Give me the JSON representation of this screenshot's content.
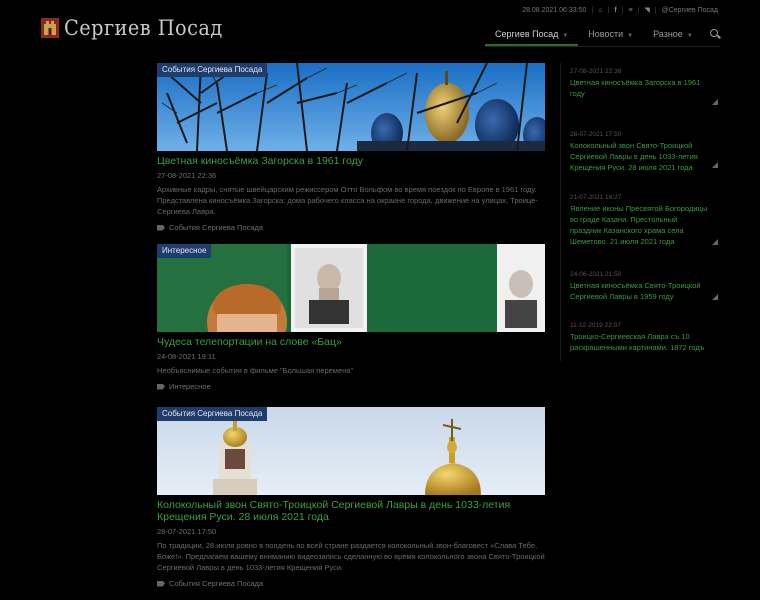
{
  "header": {
    "logo_text": "Сергиев Посад",
    "datetime": "28.08.2021 06:33:50",
    "social_handle": "@Сергиев Посад",
    "nav": [
      {
        "label": "Сергиев Посад",
        "active": true
      },
      {
        "label": "Новости",
        "active": false
      },
      {
        "label": "Разное",
        "active": false
      }
    ],
    "icons": [
      "home-icon",
      "facebook-icon",
      "menu-icon",
      "rss-icon"
    ]
  },
  "articles": [
    {
      "badge": "События Сергиева Посада",
      "title": "Цветная киносъёмка Загорска в 1961 году",
      "date": "27-08-2021 22:36",
      "desc": "Архивные кадры, снятые швейцарским режиссером Отто Вольфом во время поездок по Европе в 1961 году. Представлена киносъёмка Загорска: дома рабочего класса на окраине города, движение на улицах, Троице-Сергиева Лавра.",
      "tag": "События Сергиева Посада"
    },
    {
      "badge": "Интересное",
      "title": "Чудеса телепортации на слове «Бац»",
      "date": "24-08-2021 19:11",
      "desc": "Необъяснимые события в фильме \"Большая перемена\"",
      "tag": "Интересное"
    },
    {
      "badge": "События Сергиева Посада",
      "title": "Колокольный звон Свято-Троицкой Сергиевой Лавры в день 1033-летия Крещения Руси. 28 июля 2021 года",
      "date": "28-07-2021 17:50",
      "desc": "По традиции, 28 июля ровно в полдень по всей стране раздается колокольный звон-благовест «Слава Тебе, Боже!». Предлагаем вашему вниманию видеозапись сделанную во время колокольного звона Свято-Троицкой Сергиевой Лавры в день 1033-летия Крещения Руси.",
      "tag": "События Сергиева Посада"
    }
  ],
  "sidebar": [
    {
      "date": "27-08-2021 22:36",
      "title": "Цветная киносъёмка Загорска в 1961 году"
    },
    {
      "date": "28-07-2021 17:50",
      "title": "Колокольный звон Свято-Троицкой Сергиевой Лавры в день 1033-летия Крещения Руси. 28 июля 2021 года"
    },
    {
      "date": "21-07-2021 16:27",
      "title": "Явление иконы Пресвятой Богородицы во граде Казани. Престольный праздник Казанского храма села Шеметово. 21 июля 2021 года"
    },
    {
      "date": "24-06-2021 21:50",
      "title": "Цветная киносъёмка Свято-Троицкой Сергиевой Лавры в 1959 году"
    },
    {
      "date": "11-12-2019 22:07",
      "title": "Троицко-Сергиевская Лавра съ 10 раскрашенными картинами. 1872 годъ"
    }
  ],
  "colors": {
    "accent_green": "#3aa040",
    "badge_blue": "#1e3c6e",
    "background": "#000000"
  }
}
